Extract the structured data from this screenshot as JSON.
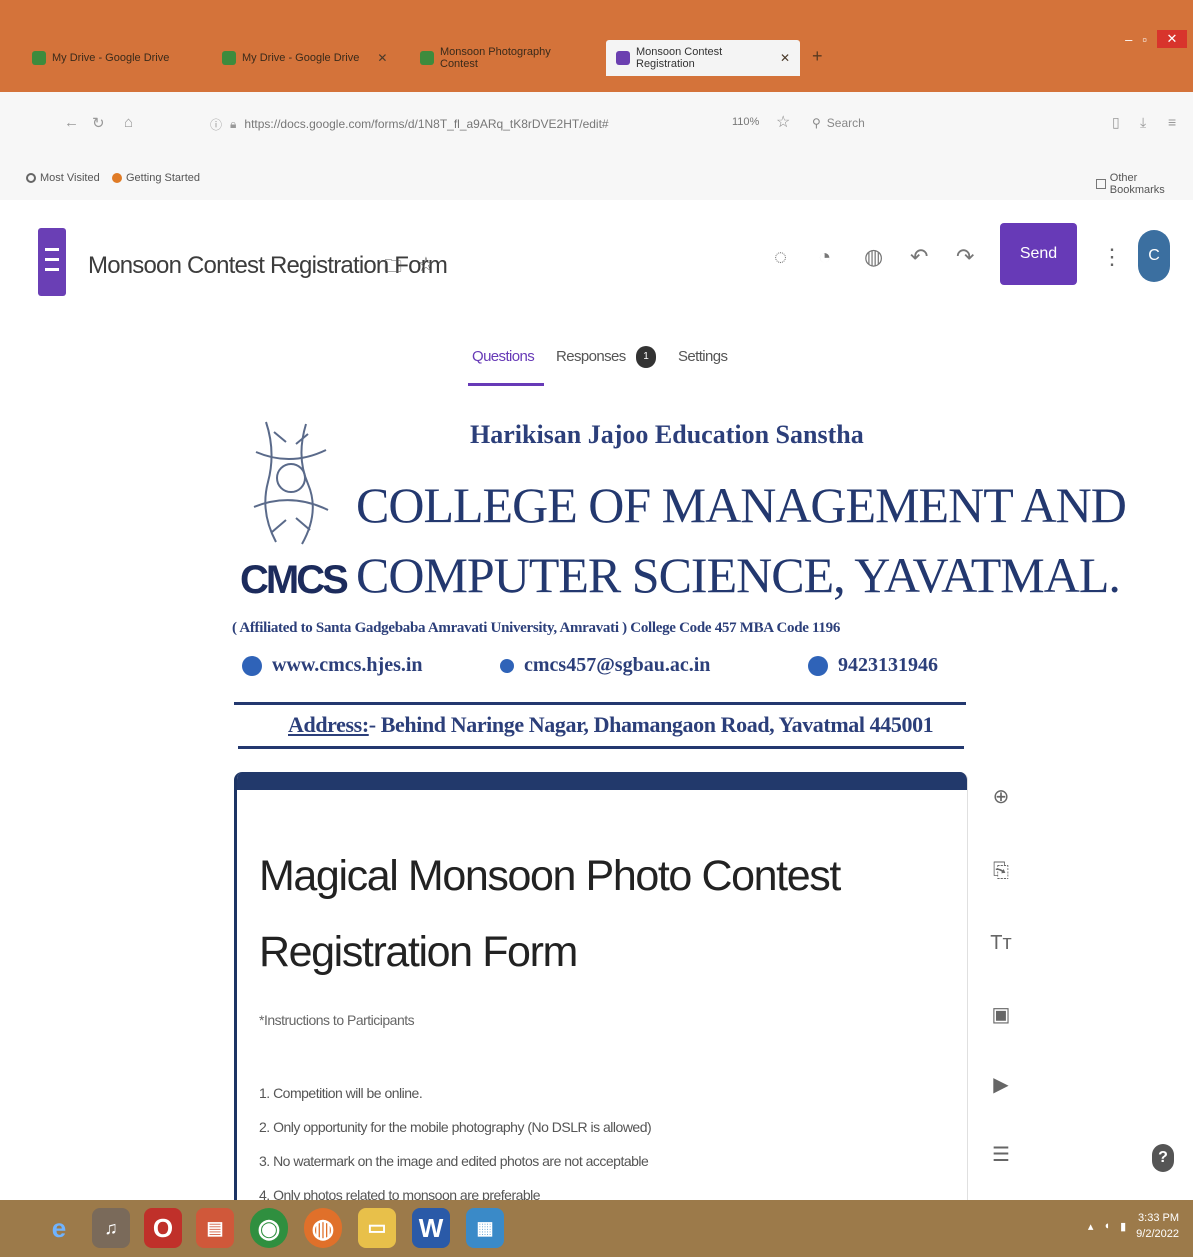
{
  "browser": {
    "tabs": [
      {
        "label": "My Drive - Google Drive"
      },
      {
        "label": "My Drive - Google Drive"
      },
      {
        "label": "Monsoon Photography Contest"
      },
      {
        "label": "Monsoon Contest Registration"
      }
    ],
    "new_tab_glyph": "+",
    "url": "https://docs.google.com/forms/d/1N8T_fl_a9ARq_tK8rDVE2HT/edit#",
    "zoom": "110%",
    "search_placeholder": "Search",
    "bookmarks": {
      "most_visited": "Most Visited",
      "getting_started": "Getting Started",
      "other_bookmarks": "Other Bookmarks"
    }
  },
  "forms": {
    "title": "Monsoon Contest Registration Form",
    "send_label": "Send",
    "avatar_initial": "C",
    "tabs": {
      "questions": "Questions",
      "responses": "Responses",
      "responses_count": "1",
      "settings": "Settings"
    }
  },
  "banner": {
    "trust": "Harikisan Jajoo Education Sanstha",
    "college_line1": "COLLEGE OF MANAGEMENT AND",
    "college_line2": "COMPUTER SCIENCE, YAVATMAL.",
    "logo_text": "CMCS",
    "affiliation": "( Affiliated to Santa Gadgebaba Amravati University, Amravati ) College Code 457    MBA Code 1196",
    "website": "www.cmcs.hjes.in",
    "email": "cmcs457@sgbau.ac.in",
    "phone": "9423131946",
    "address_label": "Address:",
    "address_text": "- Behind Naringe Nagar, Dhamangaon Road, Yavatmal 445001"
  },
  "form_card": {
    "title": "Magical Monsoon Photo Contest Registration Form",
    "description": "*Instructions to Participants",
    "rules": [
      "1. Competition will be online.",
      "2. Only opportunity for the mobile photography (No DSLR is allowed)",
      "3. No watermark on the image and edited photos are not acceptable",
      "4. Only photos related to monsoon are preferable"
    ]
  },
  "taskbar": {
    "time": "3:33 PM",
    "date": "9/2/2022"
  },
  "colors": {
    "forms_purple": "#673ab7",
    "banner_navy": "#23386f",
    "tabbar_orange": "#d4733a"
  }
}
